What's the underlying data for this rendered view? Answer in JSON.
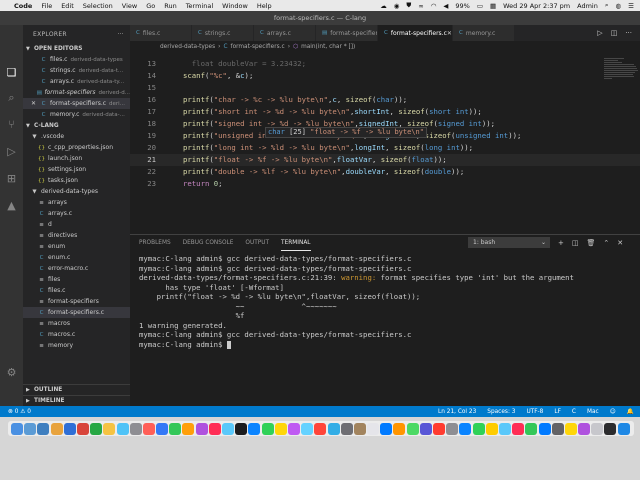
{
  "menubar": {
    "apple": "",
    "items": [
      "Code",
      "File",
      "Edit",
      "Selection",
      "View",
      "Go",
      "Run",
      "Terminal",
      "Window",
      "Help"
    ],
    "battery": "99%",
    "datetime": "Wed 29 Apr  2:37 pm",
    "user": "Admin"
  },
  "window": {
    "title": "format-specifiers.c — C-lang"
  },
  "activity": {
    "icons": [
      "files-icon",
      "search-icon",
      "source-control-icon",
      "run-debug-icon",
      "extensions-icon",
      "remote-icon",
      "accounts-icon",
      "settings-gear-icon"
    ]
  },
  "sidebar": {
    "title": "EXPLORER",
    "open_editors_label": "OPEN EDITORS",
    "open_editors": [
      {
        "name": "files.c",
        "dir": "derived-data-types"
      },
      {
        "name": "strings.c",
        "dir": "derived-data-t..."
      },
      {
        "name": "arrays.c",
        "dir": "derived-data-ty..."
      },
      {
        "name": "format-specifiers",
        "dir": "derived-d..."
      },
      {
        "name": "format-specifiers.c",
        "dir": "deri..."
      },
      {
        "name": "memory.c",
        "dir": "derived-data-..."
      }
    ],
    "workspace_label": "C-LANG",
    "tree": [
      {
        "name": ".vscode",
        "kind": "folder",
        "indent": 1
      },
      {
        "name": "c_cpp_properties.json",
        "kind": "json",
        "indent": 2
      },
      {
        "name": "launch.json",
        "kind": "json",
        "indent": 2
      },
      {
        "name": "settings.json",
        "kind": "json",
        "indent": 2
      },
      {
        "name": "tasks.json",
        "kind": "json",
        "indent": 2
      },
      {
        "name": "derived-data-types",
        "kind": "folder",
        "indent": 1
      },
      {
        "name": "arrays",
        "kind": "file",
        "indent": 2
      },
      {
        "name": "arrays.c",
        "kind": "c",
        "indent": 2
      },
      {
        "name": "d",
        "kind": "file",
        "indent": 2
      },
      {
        "name": "directives",
        "kind": "file",
        "indent": 2
      },
      {
        "name": "enum",
        "kind": "file",
        "indent": 2
      },
      {
        "name": "enum.c",
        "kind": "c",
        "indent": 2
      },
      {
        "name": "error-macro.c",
        "kind": "c",
        "indent": 2
      },
      {
        "name": "files",
        "kind": "file",
        "indent": 2
      },
      {
        "name": "files.c",
        "kind": "c",
        "indent": 2
      },
      {
        "name": "format-specifiers",
        "kind": "file",
        "indent": 2
      },
      {
        "name": "format-specifiers.c",
        "kind": "c",
        "indent": 2
      },
      {
        "name": "macros",
        "kind": "file",
        "indent": 2
      },
      {
        "name": "macros.c",
        "kind": "c",
        "indent": 2
      },
      {
        "name": "memory",
        "kind": "file",
        "indent": 2
      }
    ],
    "outline_label": "OUTLINE",
    "timeline_label": "TIMELINE"
  },
  "tabs": [
    {
      "label": "files.c",
      "active": false
    },
    {
      "label": "strings.c",
      "active": false
    },
    {
      "label": "arrays.c",
      "active": false
    },
    {
      "label": "format-specifiers",
      "active": false
    },
    {
      "label": "format-specifiers.c",
      "active": true
    },
    {
      "label": "memory.c",
      "active": false
    }
  ],
  "breadcrumb": [
    "derived-data-types",
    "C",
    "format-specifiers.c",
    "main(int, char * [])"
  ],
  "editor": {
    "lines": [
      {
        "n": "13",
        "text": ""
      },
      {
        "n": "14",
        "text": "scanf(\"%c\", &c);"
      },
      {
        "n": "15",
        "text": ""
      },
      {
        "n": "16",
        "text": "printf(\"char -> %c -> %lu byte\\n\",c, sizeof(char));"
      },
      {
        "n": "17",
        "text": "printf(\"short int -> %d -> %lu byte\\n\",shortInt, sizeof(short int));"
      },
      {
        "n": "18",
        "text": "printf(\"signed int -> %d -> %lu byte\\n\",signedInt, sizeof(signed int));"
      },
      {
        "n": "19",
        "text": "printf(\"unsigned int -> %u -> %lu byte\\n\",unsignedInt, sizeof(unsigned int));"
      },
      {
        "n": "20",
        "text": "printf(\"long int -> %ld -> %lu byte\\n\",longInt, sizeof(long int));"
      },
      {
        "n": "21",
        "text": "printf(\"float -> %f -> %lu byte\\n\",floatVar, sizeof(float));"
      },
      {
        "n": "22",
        "text": "printf(\"double -> %lf -> %lu byte\\n\",doubleVar, sizeof(double));"
      },
      {
        "n": "23",
        "text": "return 0;"
      }
    ],
    "hover": {
      "type": "char",
      "size": "[25]",
      "value": "\"float -> %f -> %lu byte\\n\""
    }
  },
  "panel": {
    "tabs": [
      "PROBLEMS",
      "DEBUG CONSOLE",
      "OUTPUT",
      "TERMINAL"
    ],
    "active_tab": "TERMINAL",
    "terminal_select": "1: bash",
    "terminal": {
      "l1": "mymac:C-lang admin$ gcc derived-data-types/format-specifiers.c",
      "l2": "mymac:C-lang admin$ gcc derived-data-types/format-specifiers.c",
      "l3a": "derived-data-types/format-specifiers.c:21:39: ",
      "l3b": "warning:",
      "l3c": " format specifies type 'int' but the argument",
      "l4": "      has type 'float' [-Wformat]",
      "l5": "    printf(\"float -> %d -> %lu byte\\n\",floatVar, sizeof(float));",
      "l6": "                      ~~             ^~~~~~~~",
      "l7": "                      %f",
      "l8": "1 warning generated.",
      "l9": "mymac:C-lang admin$ gcc derived-data-types/format-specifiers.c",
      "l10": "mymac:C-lang admin$ "
    }
  },
  "statusbar": {
    "problems": "⊗ 0 ⚠ 0",
    "position": "Ln 21, Col 23",
    "spaces": "Spaces: 3",
    "encoding": "UTF-8",
    "eol": "LF",
    "language": "C",
    "platform": "Mac"
  },
  "dock": {
    "apps": [
      "#4a90e2",
      "#5b9bd5",
      "#3f7fbf",
      "#e8a33d",
      "#2f6fd6",
      "#d8453b",
      "#27a744",
      "#f5c342",
      "#4fc3f7",
      "#8e8e93",
      "#ff5f57",
      "#3478f6",
      "#34c759",
      "#ff9f0a",
      "#af52de",
      "#ff2d55",
      "#5ac8fa",
      "#1c1c1e",
      "#0a84ff",
      "#30d158",
      "#ffd60a",
      "#bf5af2",
      "#64d2ff",
      "#ff453a",
      "#32ade6",
      "#6e6e73",
      "#a2845e",
      "#e5e5ea",
      "#007aff",
      "#ff9500",
      "#4cd964",
      "#5856d6",
      "#ff3b30",
      "#8e8e93",
      "#0a84ff",
      "#30d158",
      "#ffcc00",
      "#5ac8fa",
      "#ff2d55",
      "#34c759",
      "#007aff",
      "#636366",
      "#ffd60a",
      "#af52de",
      "#c7c7cc",
      "#2c2c2e",
      "#1e88e5"
    ]
  }
}
